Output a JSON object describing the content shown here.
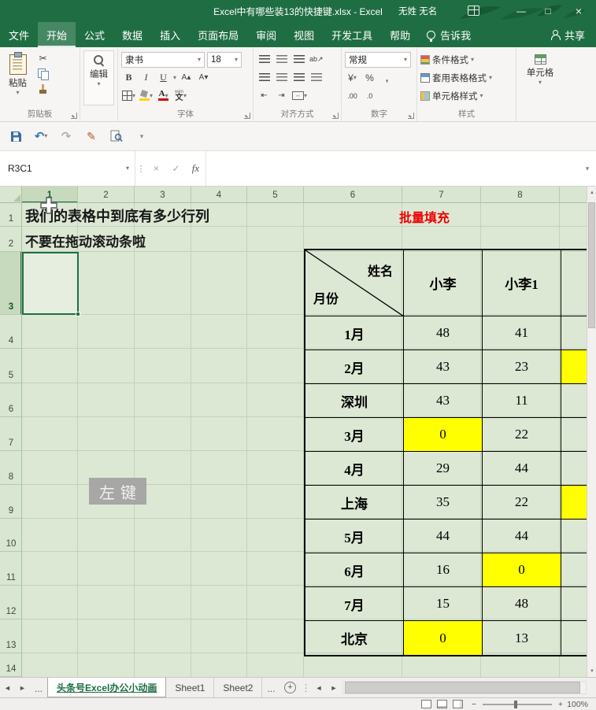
{
  "icons": {
    "dropdown": "▾",
    "up": "▲",
    "down": "▼",
    "prev": "◄",
    "next": "►",
    "scissors": "✂",
    "undo": "↶",
    "redo": "↷",
    "pen": "✎",
    "check": "✓",
    "cancel": "×",
    "more_v": "⋮",
    "bold": "B",
    "italic": "I",
    "underline": "U",
    "grow_font": "A▴",
    "shrink_font": "A▾",
    "orientation": "ab↗",
    "indent_left": "⇤",
    "indent_right": "⇥"
  },
  "titlebar": {
    "title": "Excel中有哪些装13的快捷键.xlsx  -  Excel",
    "user": "无姓 无名",
    "minimize": "—",
    "maximize": "□",
    "close": "×"
  },
  "ribbon": {
    "tabs": [
      {
        "label": "文件"
      },
      {
        "label": "开始",
        "active": true
      },
      {
        "label": "公式"
      },
      {
        "label": "数据"
      },
      {
        "label": "插入"
      },
      {
        "label": "页面布局"
      },
      {
        "label": "审阅"
      },
      {
        "label": "视图"
      },
      {
        "label": "开发工具"
      },
      {
        "label": "帮助"
      }
    ],
    "tellme": "告诉我",
    "share": "共享",
    "clipboard": {
      "paste": "粘贴",
      "group_label": "剪贴板"
    },
    "edit": {
      "label": "编辑"
    },
    "font": {
      "name": "隶书",
      "size": "18",
      "pinyin_mark": "wén",
      "pinyin_main": "文",
      "group_label": "字体"
    },
    "alignment": {
      "group_label": "对齐方式"
    },
    "number": {
      "format": "常规",
      "currency": "¥",
      "percent": "%",
      "comma": ",",
      "dec_inc": ".00",
      "dec_dec": ".0",
      "group_label": "数字"
    },
    "styles": {
      "items": [
        {
          "label": "条件格式"
        },
        {
          "label": "套用表格格式"
        },
        {
          "label": "单元格样式"
        }
      ],
      "group_label": "样式"
    },
    "cells": {
      "label": "单元格"
    }
  },
  "formula_bar": {
    "name_box": "R3C1",
    "fx_label": "fx"
  },
  "sheet": {
    "col_headers": [
      "1",
      "2",
      "3",
      "4",
      "5",
      "6",
      "7",
      "8"
    ],
    "row_headers": [
      "1",
      "2",
      "3",
      "4",
      "5",
      "6",
      "7",
      "8",
      "9",
      "10",
      "11",
      "12",
      "13",
      "14"
    ],
    "selected_ref": "R3C1",
    "notes": {
      "line1": "我们的表格中到底有多少行列",
      "line2": "不要在拖动滚动条啦",
      "fill_label": "批量填充",
      "mouse_overlay": "左键"
    },
    "table": {
      "corner_top": "姓名",
      "corner_bottom": "月份",
      "columns": [
        "小李",
        "小李1",
        ""
      ],
      "rows": [
        {
          "label": "1月",
          "values": [
            "48",
            "41",
            ""
          ],
          "yellow": []
        },
        {
          "label": "2月",
          "values": [
            "43",
            "23",
            ""
          ],
          "yellow": [
            2
          ]
        },
        {
          "label": "深圳",
          "values": [
            "43",
            "11",
            ""
          ],
          "yellow": []
        },
        {
          "label": "3月",
          "values": [
            "0",
            "22",
            ""
          ],
          "yellow": [
            0
          ]
        },
        {
          "label": "4月",
          "values": [
            "29",
            "44",
            ""
          ],
          "yellow": []
        },
        {
          "label": "上海",
          "values": [
            "35",
            "22",
            ""
          ],
          "yellow": [
            2
          ]
        },
        {
          "label": "5月",
          "values": [
            "44",
            "44",
            ""
          ],
          "yellow": []
        },
        {
          "label": "6月",
          "values": [
            "16",
            "0",
            ""
          ],
          "yellow": [
            1
          ]
        },
        {
          "label": "7月",
          "values": [
            "15",
            "48",
            ""
          ],
          "yellow": []
        },
        {
          "label": "北京",
          "values": [
            "0",
            "13",
            ""
          ],
          "yellow": [
            0
          ]
        }
      ]
    }
  },
  "sheet_tabs": {
    "ellipsis_left": "...",
    "sheets": [
      {
        "label": "头条号Excel办公小动画",
        "active": true
      },
      {
        "label": "Sheet1"
      },
      {
        "label": "Sheet2"
      }
    ],
    "ellipsis_right": "...",
    "add": "+"
  },
  "status_bar": {
    "zoom": "100%",
    "zoom_out": "−",
    "zoom_in": "+"
  }
}
